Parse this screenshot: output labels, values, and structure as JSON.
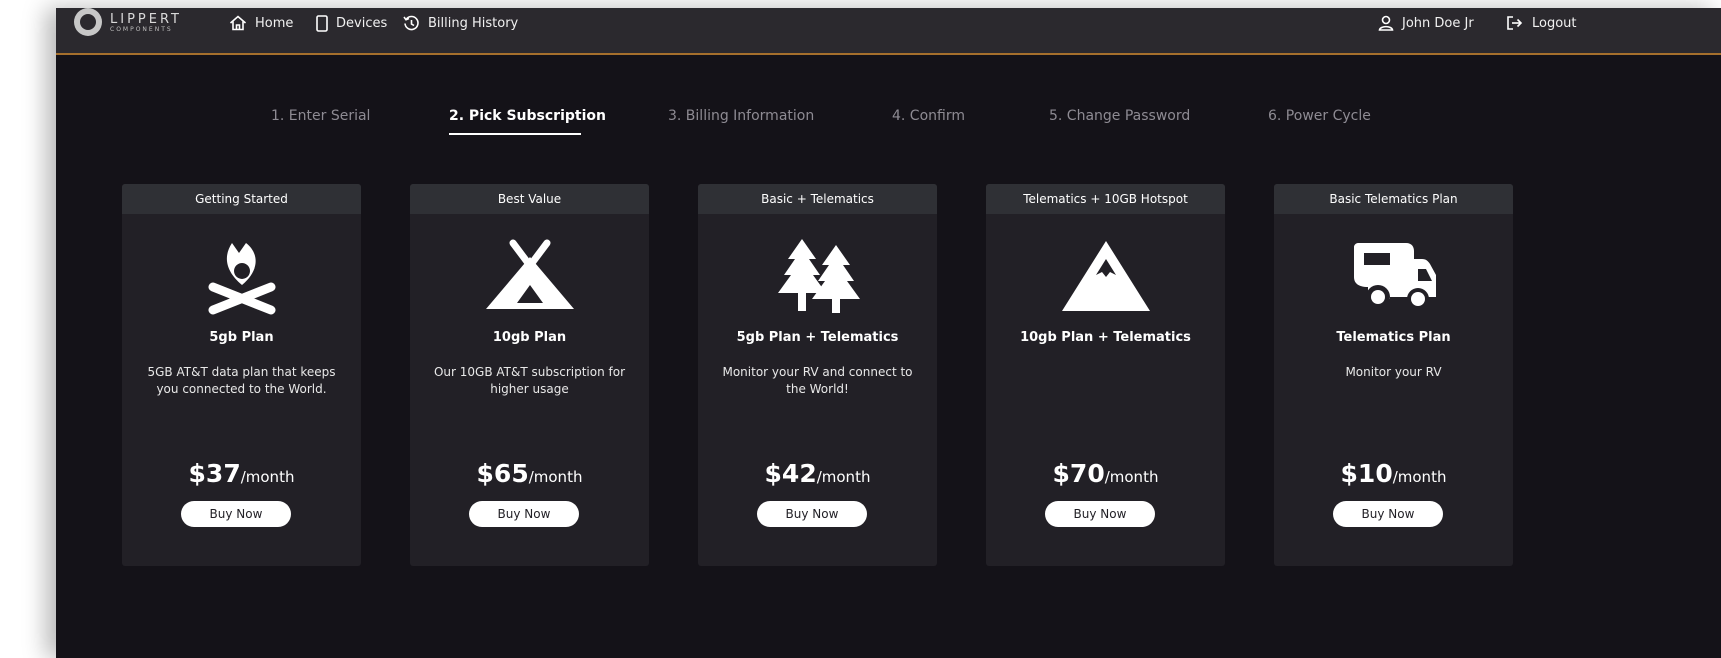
{
  "brand": {
    "name": "LIPPERT",
    "sub": "COMPONENTS"
  },
  "nav": {
    "home": "Home",
    "devices": "Devices",
    "billing_history": "Billing History",
    "user": "John Doe Jr",
    "logout": "Logout"
  },
  "steps": [
    {
      "label": "1. Enter Serial",
      "active": false
    },
    {
      "label": "2. Pick Subscription",
      "active": true
    },
    {
      "label": "3. Billing Information",
      "active": false
    },
    {
      "label": "4. Confirm",
      "active": false
    },
    {
      "label": "5. Change Password",
      "active": false
    },
    {
      "label": "6. Power Cycle",
      "active": false
    }
  ],
  "plans": [
    {
      "header": "Getting Started",
      "icon": "campfire-icon",
      "name": "5gb Plan",
      "description": "5GB AT&T data plan that keeps you connected to the World.",
      "price": "$37",
      "period": "/month",
      "button": "Buy Now"
    },
    {
      "header": "Best Value",
      "icon": "tent-icon",
      "name": "10gb Plan",
      "description": "Our 10GB AT&T subscription for higher usage",
      "price": "$65",
      "period": "/month",
      "button": "Buy Now"
    },
    {
      "header": "Basic + Telematics",
      "icon": "trees-icon",
      "name": "5gb Plan + Telematics",
      "description": "Monitor your RV and connect to the World!",
      "price": "$42",
      "period": "/month",
      "button": "Buy Now"
    },
    {
      "header": "Telematics + 10GB Hotspot",
      "icon": "mountain-icon",
      "name": "10gb Plan + Telematics",
      "description": "",
      "price": "$70",
      "period": "/month",
      "button": "Buy Now"
    },
    {
      "header": "Basic Telematics Plan",
      "icon": "rv-icon",
      "name": "Telematics Plan",
      "description": "Monitor your RV",
      "price": "$10",
      "period": "/month",
      "button": "Buy Now"
    }
  ],
  "colors": {
    "background": "#141218",
    "header_bar": "#2b292e",
    "accent_line": "#a56f2c",
    "card": "#222026",
    "card_header": "#2f3035"
  }
}
